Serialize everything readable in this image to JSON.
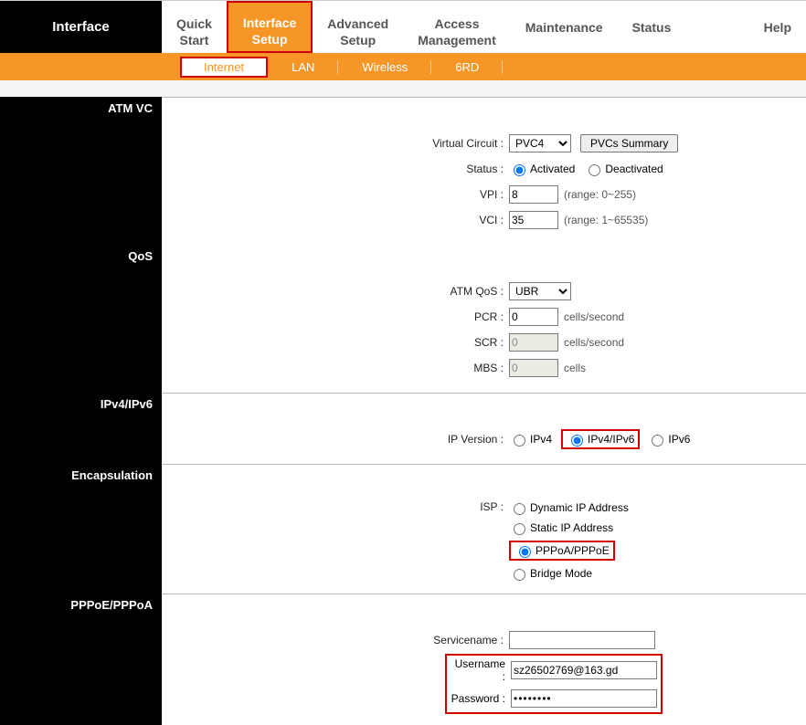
{
  "brand": "Interface",
  "tabs": {
    "quick_start": "Quick\nStart",
    "interface_setup": "Interface\nSetup",
    "advanced_setup": "Advanced\nSetup",
    "access_management": "Access\nManagement",
    "maintenance": "Maintenance",
    "status": "Status",
    "help": "Help"
  },
  "subnav": {
    "internet": "Internet",
    "lan": "LAN",
    "wireless": "Wireless",
    "sixrd": "6RD"
  },
  "sections": {
    "atm_vc": "ATM VC",
    "qos": "QoS",
    "ipv4ipv6": "IPv4/IPv6",
    "encapsulation": "Encapsulation",
    "pppoe": "PPPoE/PPPoA"
  },
  "atm": {
    "vc_label": "Virtual Circuit :",
    "vc_value": "PVC4",
    "pvcs_btn": "PVCs Summary",
    "status_label": "Status :",
    "status_activated": "Activated",
    "status_deactivated": "Deactivated",
    "vpi_label": "VPI :",
    "vpi_value": "8",
    "vpi_range": "(range: 0~255)",
    "vci_label": "VCI :",
    "vci_value": "35",
    "vci_range": "(range: 1~65535)"
  },
  "qos": {
    "atmqos_label": "ATM QoS :",
    "atmqos_value": "UBR",
    "pcr_label": "PCR :",
    "pcr_value": "0",
    "pcr_unit": "cells/second",
    "scr_label": "SCR :",
    "scr_value": "0",
    "scr_unit": "cells/second",
    "mbs_label": "MBS :",
    "mbs_value": "0",
    "mbs_unit": "cells"
  },
  "ipver": {
    "label": "IP Version :",
    "ipv4": "IPv4",
    "ipv4ipv6": "IPv4/IPv6",
    "ipv6": "IPv6"
  },
  "isp": {
    "label": "ISP :",
    "dynamic": "Dynamic IP Address",
    "static": "Static IP Address",
    "pppoa": "PPPoA/PPPoE",
    "bridge": "Bridge Mode"
  },
  "ppp": {
    "servicename_label": "Servicename :",
    "servicename_value": "",
    "username_label": "Username :",
    "username_value": "sz26502769@163.gd",
    "password_label": "Password :",
    "password_value": "••••••••"
  }
}
